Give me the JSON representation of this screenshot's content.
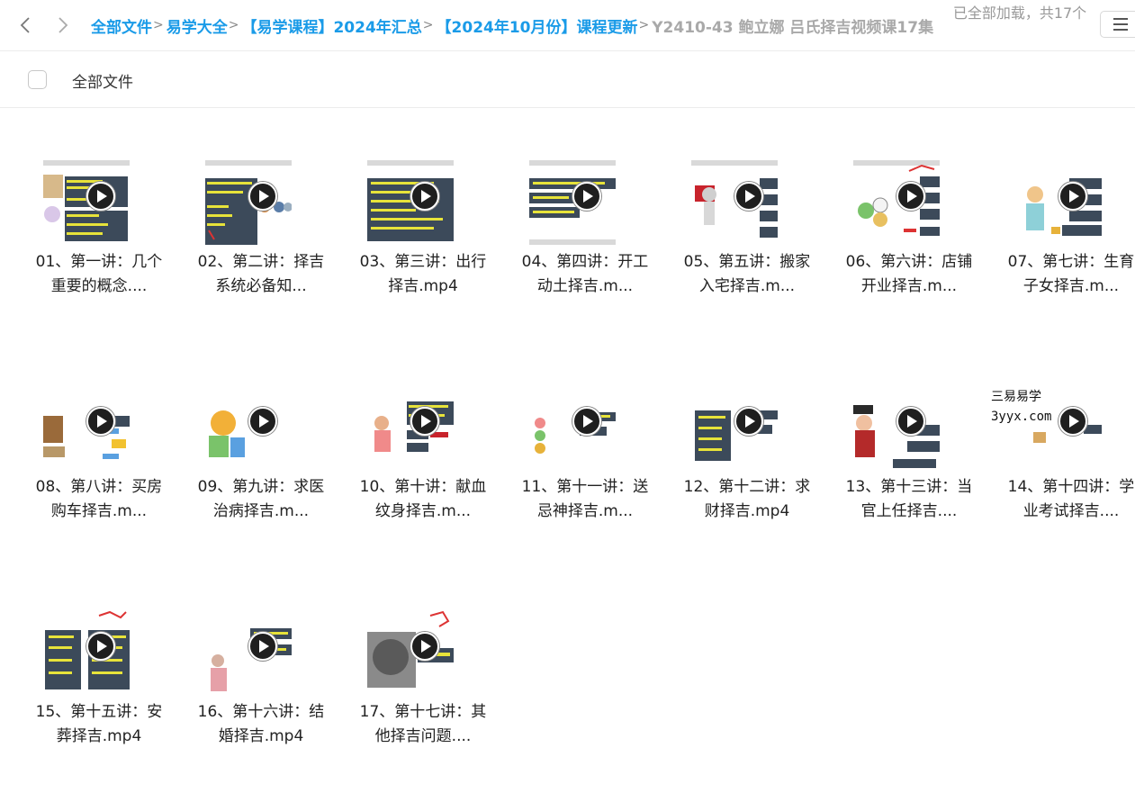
{
  "nav": {
    "back_icon": "chevron-left-icon",
    "forward_icon": "chevron-right-icon"
  },
  "breadcrumb": [
    {
      "label": "全部文件"
    },
    {
      "label": "易学大全"
    },
    {
      "label": "【易学课程】2024年汇总"
    },
    {
      "label": "【2024年10月份】课程更新"
    },
    {
      "label": "Y2410-43 鲍立娜 吕氏择吉视频课17集"
    }
  ],
  "breadcrumb_separator": ">",
  "status_text": "已全部加载，共17个",
  "menu_icon": "hamburger-menu-icon",
  "select_all_label": "全部文件",
  "files": [
    {
      "name": "01、第一讲：几个重要的概念...."
    },
    {
      "name": "02、第二讲：择吉系统必备知..."
    },
    {
      "name": "03、第三讲：出行择吉.mp4"
    },
    {
      "name": "04、第四讲：开工动土择吉.m..."
    },
    {
      "name": "05、第五讲：搬家入宅择吉.m..."
    },
    {
      "name": "06、第六讲：店铺开业择吉.m..."
    },
    {
      "name": "07、第七讲：生育子女择吉.m..."
    },
    {
      "name": "08、第八讲：买房购车择吉.m..."
    },
    {
      "name": "09、第九讲：求医治病择吉.m..."
    },
    {
      "name": "10、第十讲：献血纹身择吉.m..."
    },
    {
      "name": "11、第十一讲：送忌神择吉.m..."
    },
    {
      "name": "12、第十二讲：求财择吉.mp4"
    },
    {
      "name": "13、第十三讲：当官上任择吉...."
    },
    {
      "name": "14、第十四讲：学业考试择吉...."
    },
    {
      "name": "15、第十五讲：安葬择吉.mp4"
    },
    {
      "name": "16、第十六讲：结婚择吉.mp4"
    },
    {
      "name": "17、第十七讲：其他择吉问题...."
    }
  ],
  "watermark": {
    "line1": "三易易学",
    "line2": "3yyx.com"
  },
  "colors": {
    "link": "#1a9be8",
    "current_crumb": "#a9a9a9"
  }
}
